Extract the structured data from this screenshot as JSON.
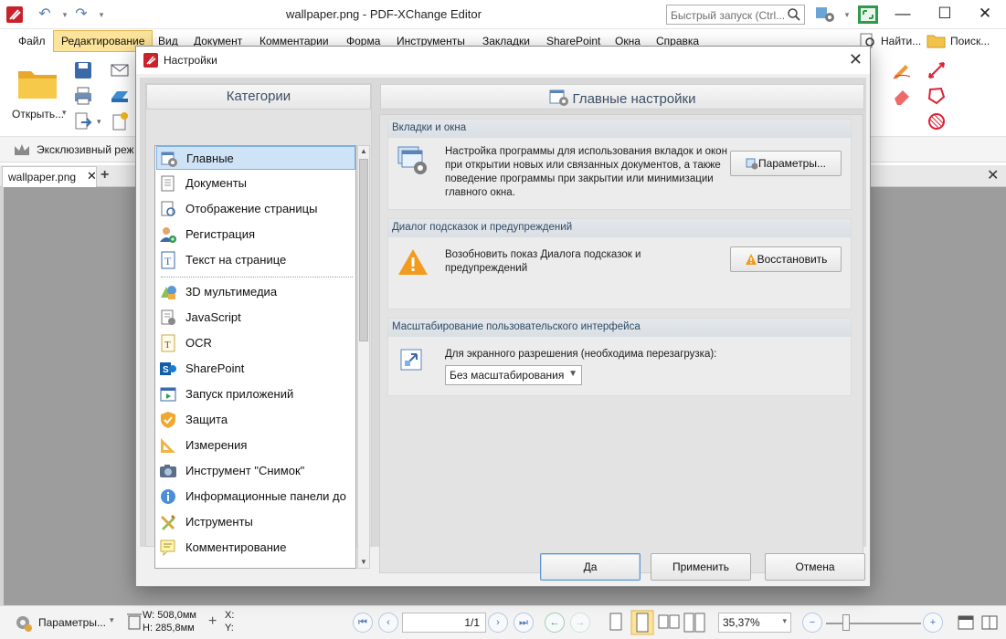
{
  "window": {
    "title": "wallpaper.png - PDF-XChange Editor",
    "quick_launch_placeholder": "Быстрый запуск (Ctrl..."
  },
  "menu": {
    "items": [
      "Файл",
      "Редактирование",
      "Вид",
      "Документ",
      "Комментарии",
      "Форма",
      "Инструменты",
      "Закладки",
      "SharePoint",
      "Окна",
      "Справка"
    ],
    "active_index": 1,
    "find_label": "Найти...",
    "search_label": "Поиск..."
  },
  "ribbon": {
    "open_label": "Открыть...",
    "exclusive_label": "Эксклюзивный реж"
  },
  "doc_tab": {
    "label": "wallpaper.png"
  },
  "status": {
    "params_label": "Параметры...",
    "width": "W: 508,0мм",
    "height": "H: 285,8мм",
    "x": "X:",
    "y": "Y:",
    "page": "1/1",
    "zoom": "35,37%"
  },
  "dialog": {
    "title": "Настройки",
    "categories_header": "Категории",
    "main_header": "Главные настройки",
    "categories": [
      {
        "label": "Главные",
        "icon": "main-settings-icon"
      },
      {
        "label": "Документы",
        "icon": "documents-icon"
      },
      {
        "label": "Отображение страницы",
        "icon": "page-display-icon"
      },
      {
        "label": "Регистрация",
        "icon": "registration-icon"
      },
      {
        "label": "Текст на странице",
        "icon": "page-text-icon"
      },
      {
        "label": "3D мультимедиа",
        "icon": "multimedia-3d-icon"
      },
      {
        "label": "JavaScript",
        "icon": "javascript-icon"
      },
      {
        "label": "OCR",
        "icon": "ocr-icon"
      },
      {
        "label": "SharePoint",
        "icon": "sharepoint-icon"
      },
      {
        "label": "Запуск приложений",
        "icon": "app-launch-icon"
      },
      {
        "label": "Защита",
        "icon": "security-icon"
      },
      {
        "label": "Измерения",
        "icon": "measurements-icon"
      },
      {
        "label": "Инструмент \"Снимок\"",
        "icon": "snapshot-icon"
      },
      {
        "label": "Информационные панели до",
        "icon": "info-panels-icon"
      },
      {
        "label": "Иструменты",
        "icon": "tools-icon"
      },
      {
        "label": "Комментирование",
        "icon": "commenting-icon"
      }
    ],
    "selected_category": 0,
    "groups": {
      "tabs": {
        "title": "Вкладки и окна",
        "text": "Настройка программы для использования вкладок и окон при открытии новых или связанных документов, а также поведение программы при закрытии или минимизации главного окна.",
        "button": "Параметры..."
      },
      "tips": {
        "title": "Диалог подсказок и предупреждений",
        "text": "Возобновить показ Диалога подсказок и предупреждений",
        "button": "Восстановить"
      },
      "scaling": {
        "title": "Масштабирование пользовательского интерфейса",
        "label": "Для экранного разрешения (необходима перезагрузка):",
        "value": "Без масштабирования"
      }
    },
    "buttons": {
      "ok": "Да",
      "apply": "Применить",
      "cancel": "Отмена"
    }
  },
  "colors": {
    "accent": "#5d93cf",
    "menu_active_bg": "#fde49a",
    "selection_bg": "#cfe3f7",
    "doc_bg": "#9d9d9d",
    "app_red": "#c8232c"
  }
}
